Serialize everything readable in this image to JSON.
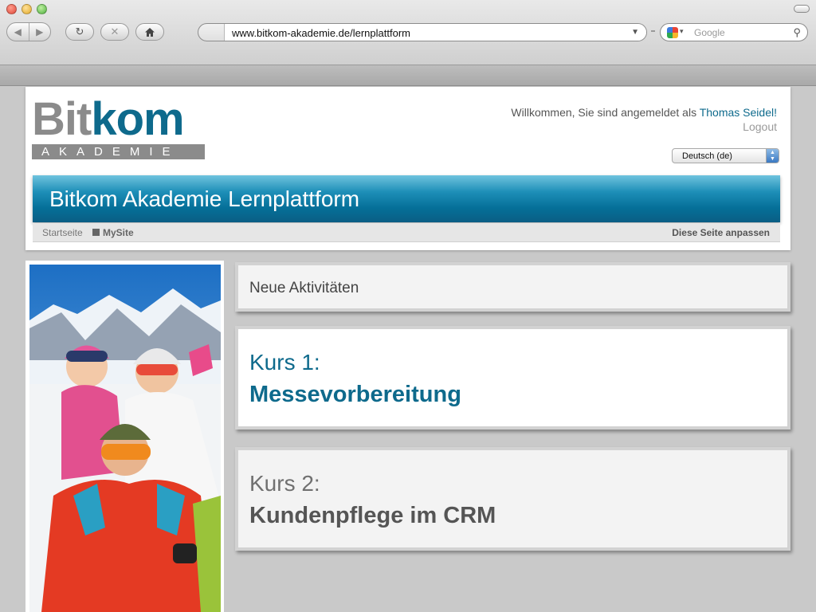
{
  "browser": {
    "url": "www.bitkom-akademie.de/lernplattform",
    "search_placeholder": "Google"
  },
  "header": {
    "logo_main_left": "Bit",
    "logo_main_right": "kom",
    "logo_sub": "AKADEMIE",
    "welcome_prefix": "Willkommen, Sie sind angemeldet als ",
    "user_name": "Thomas Seidel!",
    "logout": "Logout",
    "language": "Deutsch (de)",
    "banner_title": "Bitkom Akademie Lernplattform"
  },
  "breadcrumb": {
    "home": "Startseite",
    "current": "MySite",
    "customize": "Diese Seite anpassen"
  },
  "main": {
    "activities_title": "Neue Aktivitäten",
    "courses": [
      {
        "label": "Kurs 1:",
        "name": "Messevorbereitung"
      },
      {
        "label": "Kurs 2:",
        "name": "Kundenpflege im CRM"
      }
    ]
  },
  "colors": {
    "brand_blue": "#0e6a8c",
    "brand_gray": "#8b8b8b"
  }
}
